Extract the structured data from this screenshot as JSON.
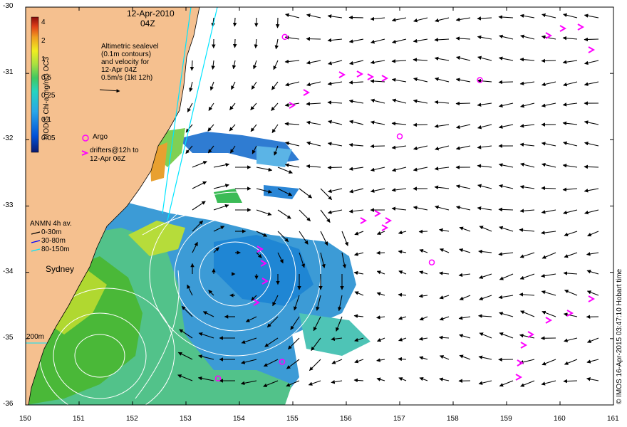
{
  "title": {
    "date": "12-Apr-2010",
    "time": "04Z"
  },
  "colorbar": {
    "label": "MODIS Chl-a mg/m3 OC3",
    "ticks": [
      "4",
      "2",
      "1",
      "0.5",
      "0.25",
      "0.1",
      "0.05"
    ]
  },
  "annotation": {
    "lines": [
      "Altimetric sealevel",
      "(0.1m contours)",
      "and velocity for",
      "12-Apr 04Z",
      "0.5m/s (1kt 12h)"
    ]
  },
  "legend": {
    "argo": "Argo",
    "drifters_line1": "drifters@12h to",
    "drifters_line2": "12-Apr 06Z",
    "anmn_title": "ANMN 4h av.",
    "anmn": [
      {
        "label": "0-30m",
        "color": "#000000"
      },
      {
        "label": "30-80m",
        "color": "#0000ff"
      },
      {
        "label": "80-150m",
        "color": "#00e5ff"
      }
    ]
  },
  "place_label": "Sydney",
  "isobath_label": "200m",
  "credit": "© IMOS 16-Apr-2015 03:47:10 Hobart time",
  "axes": {
    "lon_ticks": [
      "150",
      "151",
      "152",
      "153",
      "154",
      "155",
      "156",
      "157",
      "158",
      "159",
      "160",
      "161"
    ],
    "lat_ticks": [
      "-30",
      "-31",
      "-32",
      "-33",
      "-34",
      "-35",
      "-36"
    ]
  },
  "colors": {
    "land": "#f5c08f",
    "coast": "#000000",
    "argo": "#ff00ff",
    "drifter": "#ff00ff",
    "contour": "#ffffff"
  },
  "argo_floats": [
    {
      "lon": 154.85,
      "lat": -30.45
    },
    {
      "lon": 158.5,
      "lat": -31.1
    },
    {
      "lon": 157.0,
      "lat": -31.95
    },
    {
      "lon": 157.6,
      "lat": -33.85
    },
    {
      "lon": 154.8,
      "lat": -35.35
    },
    {
      "lon": 153.6,
      "lat": -35.6
    }
  ]
}
